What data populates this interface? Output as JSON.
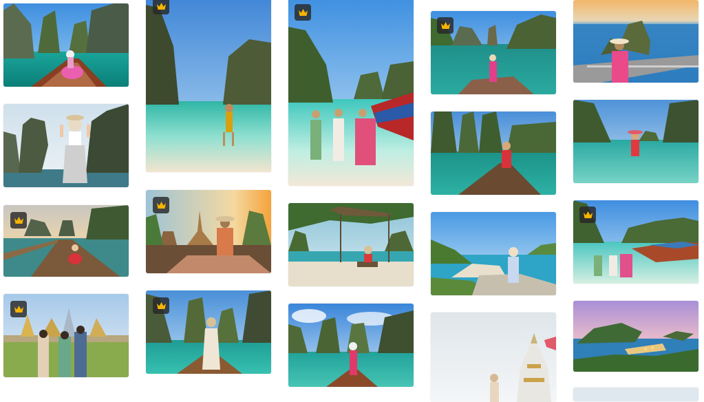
{
  "gallery": {
    "premium_icon": "crown-icon",
    "badge_bg": "#2b2b2b",
    "badge_icon_color": "#f5b400",
    "columns": [
      {
        "id": "col1",
        "images": [
          {
            "name": "longtail-boat-woman-pink-dress",
            "premium": false
          },
          {
            "name": "woman-james-bond-island",
            "premium": false
          },
          {
            "name": "woman-wooden-pier-sunset",
            "premium": true
          },
          {
            "name": "tourists-grand-palace-bangkok",
            "premium": true
          }
        ]
      },
      {
        "id": "col2",
        "images": [
          {
            "name": "woman-yellow-dress-beach",
            "premium": true
          },
          {
            "name": "woman-temple-ruins-sunset",
            "premium": true
          },
          {
            "name": "woman-boat-bow-karst-lake",
            "premium": true
          }
        ]
      },
      {
        "id": "col3",
        "images": [
          {
            "name": "three-women-phi-phi-beach",
            "premium": true
          },
          {
            "name": "woman-swing-tree-beach",
            "premium": false
          },
          {
            "name": "woman-boat-karst-lagoon",
            "premium": false
          }
        ]
      },
      {
        "id": "col4",
        "images": [
          {
            "name": "woman-rock-james-bond-island",
            "premium": true
          },
          {
            "name": "woman-boat-khao-sok-lake",
            "premium": false
          },
          {
            "name": "woman-viewpoint-koh-nang-yuan",
            "premium": false
          },
          {
            "name": "woman-white-temple-stupa",
            "premium": false
          }
        ]
      },
      {
        "id": "col5",
        "images": [
          {
            "name": "woman-railing-sunset-sea",
            "premium": false
          },
          {
            "name": "woman-wading-lagoon-red-hat",
            "premium": false
          },
          {
            "name": "tourists-speedboats-phi-phi",
            "premium": true
          },
          {
            "name": "koh-nang-yuan-aerial-dusk",
            "premium": false
          },
          {
            "name": "partial-image-bottom",
            "premium": false
          }
        ]
      }
    ]
  }
}
